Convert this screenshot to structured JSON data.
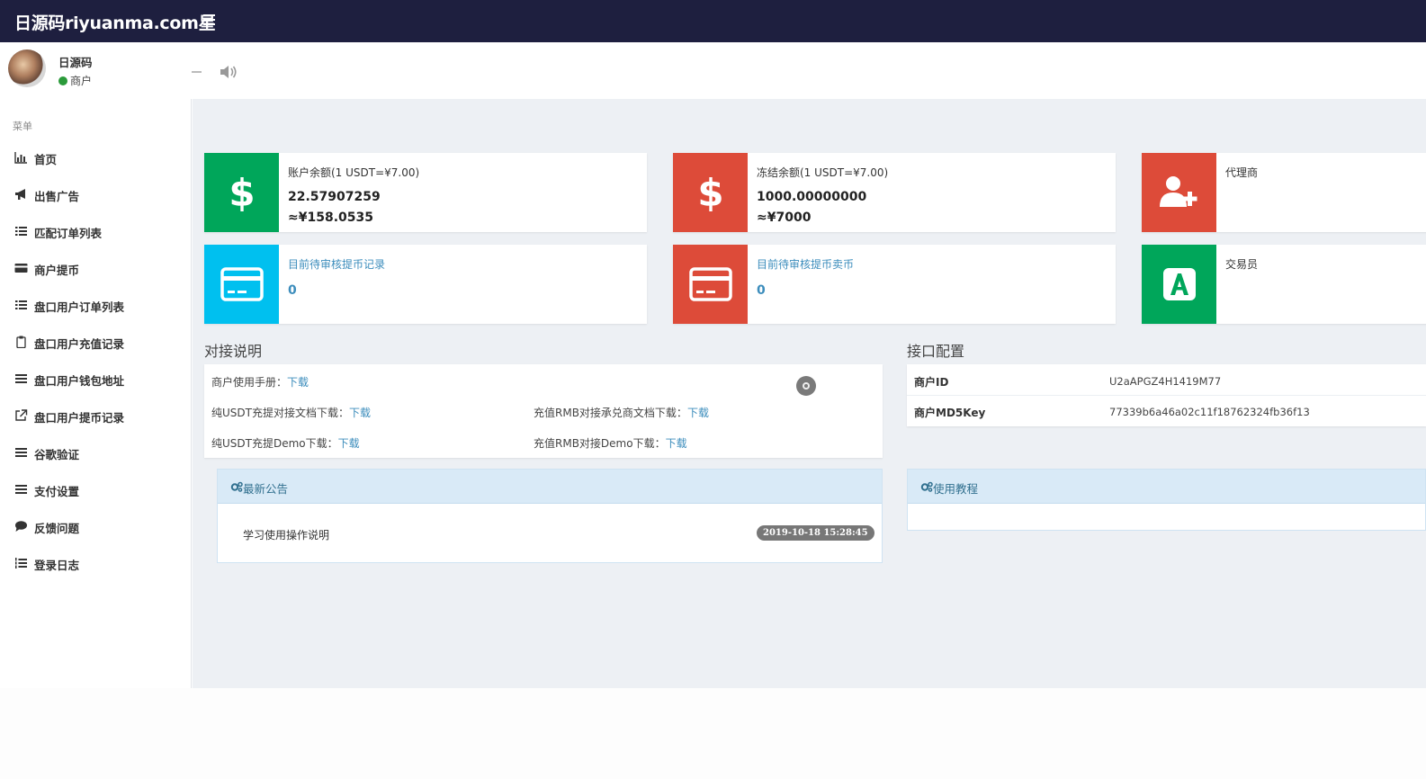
{
  "header": {
    "brand": "日源码riyuanma.com星",
    "menu_toggle_icon": "hamburger-icon"
  },
  "user": {
    "name": "日源码",
    "role": "商户",
    "status_color": "#2a9a3a"
  },
  "sidebar": {
    "heading": "菜单",
    "items": [
      {
        "label": "首页",
        "icon": "bar-chart-icon"
      },
      {
        "label": "出售广告",
        "icon": "bullhorn-icon"
      },
      {
        "label": "匹配订单列表",
        "icon": "list-icon"
      },
      {
        "label": "商户提币",
        "icon": "credit-card-icon"
      },
      {
        "label": "盘口用户订单列表",
        "icon": "list-icon"
      },
      {
        "label": "盘口用户充值记录",
        "icon": "clipboard-icon"
      },
      {
        "label": "盘口用户钱包地址",
        "icon": "bars-icon"
      },
      {
        "label": "盘口用户提币记录",
        "icon": "external-link-icon"
      },
      {
        "label": "谷歌验证",
        "icon": "bars-icon"
      },
      {
        "label": "支付设置",
        "icon": "bars-icon"
      },
      {
        "label": "反馈问题",
        "icon": "comment-icon"
      },
      {
        "label": "登录日志",
        "icon": "list-ol-icon"
      }
    ]
  },
  "cards": {
    "balance": {
      "title": "账户余额(1 USDT=¥7.00)",
      "amount": "22.57907259",
      "cny": "≈¥158.0535",
      "color": "#00a65a"
    },
    "frozen": {
      "title": "冻结余额(1 USDT=¥7.00)",
      "amount": "1000.00000000",
      "cny": "≈¥7000",
      "color": "#dd4b39"
    },
    "agent": {
      "title": "代理商",
      "color": "#dd4b39"
    },
    "pending_withdraw": {
      "title": "目前待审核提币记录",
      "count": "0",
      "color": "#00c0ef"
    },
    "pending_sell": {
      "title": "目前待审核提币卖币",
      "count": "0",
      "color": "#dd4b39"
    },
    "trader": {
      "title": "交易员",
      "color": "#00a65a"
    }
  },
  "docs": {
    "title": "对接说明",
    "download_label": "下载",
    "lines": [
      "商户使用手册：",
      "纯USDT充提对接文档下载：",
      "充值RMB对接承兑商文档下载：",
      "纯USDT充提Demo下载：",
      "充值RMB对接Demo下载："
    ]
  },
  "api": {
    "title": "接口配置",
    "merchant_id_label": "商户ID",
    "merchant_id": "U2aAPGZ4H1419M77",
    "md5_label": "商户MD5Key",
    "md5": "77339b6a46a02c11f18762324fb36f13"
  },
  "notice": {
    "title": "最新公告",
    "item": "学习使用操作说明",
    "date": "2019-10-18 15:28:45"
  },
  "tutorial": {
    "title": "使用教程"
  }
}
